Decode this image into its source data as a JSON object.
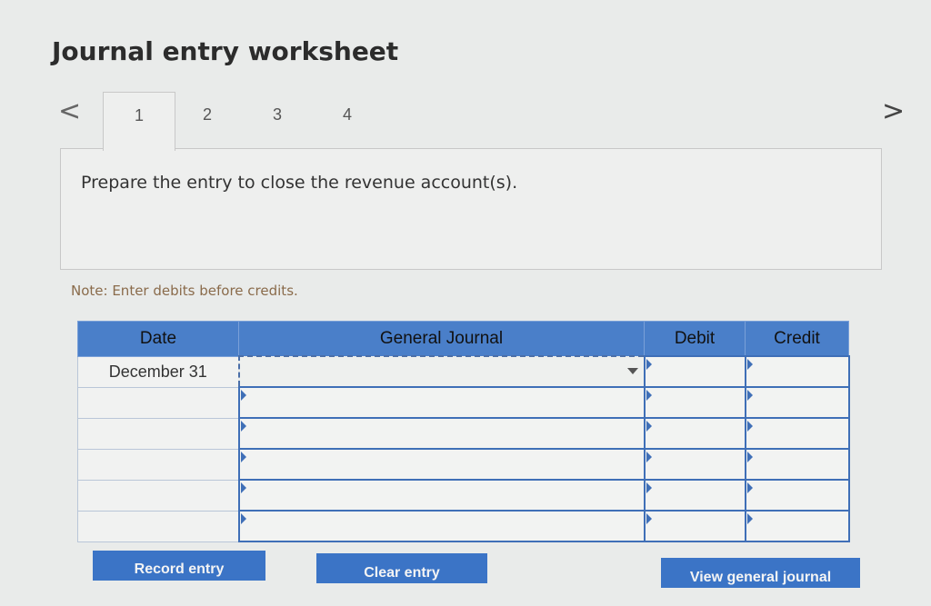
{
  "worksheet": {
    "title": "Journal entry worksheet",
    "prev_arrow": "<",
    "next_arrow": ">",
    "tabs": [
      {
        "label": "1",
        "active": true
      },
      {
        "label": "2",
        "active": false
      },
      {
        "label": "3",
        "active": false
      },
      {
        "label": "4",
        "active": false
      }
    ],
    "instruction": "Prepare the entry to close the revenue account(s).",
    "note": "Note: Enter debits before credits."
  },
  "table": {
    "headers": {
      "date": "Date",
      "general_journal": "General Journal",
      "debit": "Debit",
      "credit": "Credit"
    },
    "rows": [
      {
        "date": "December 31",
        "account": "",
        "debit": "",
        "credit": ""
      },
      {
        "date": "",
        "account": "",
        "debit": "",
        "credit": ""
      },
      {
        "date": "",
        "account": "",
        "debit": "",
        "credit": ""
      },
      {
        "date": "",
        "account": "",
        "debit": "",
        "credit": ""
      },
      {
        "date": "",
        "account": "",
        "debit": "",
        "credit": ""
      },
      {
        "date": "",
        "account": "",
        "debit": "",
        "credit": ""
      }
    ]
  },
  "buttons": {
    "record": "Record entry",
    "clear": "Clear entry",
    "view": "View general journal"
  },
  "colors": {
    "header_blue": "#4a7fc9",
    "button_blue": "#3b74c6",
    "note_text": "#8a6b4b"
  }
}
